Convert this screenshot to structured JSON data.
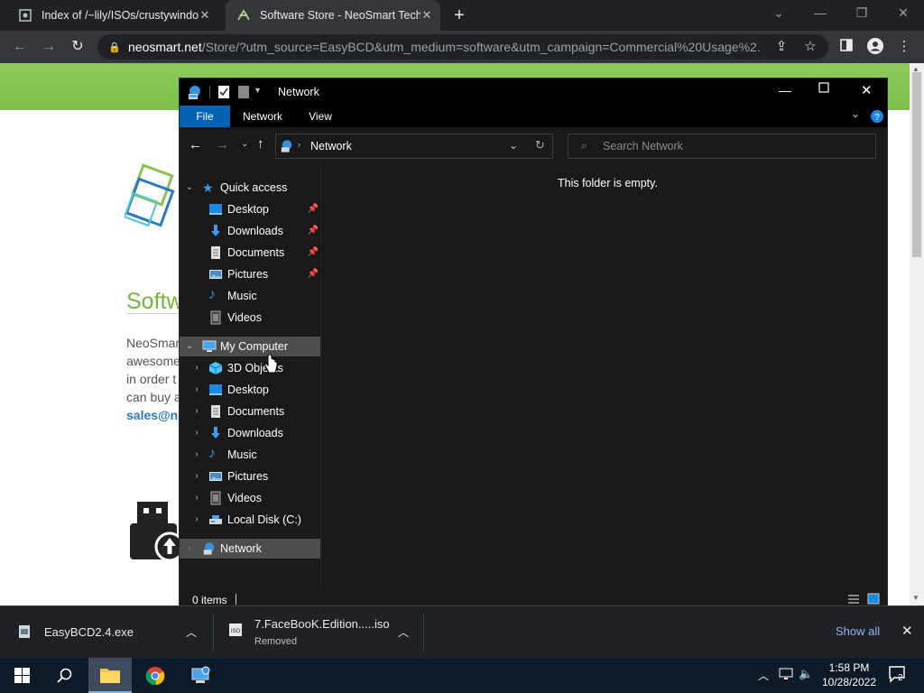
{
  "browser": {
    "tabs": [
      {
        "title": "Index of /~lily/ISOs/crustywindo"
      },
      {
        "title": "Software Store - NeoSmart Techn"
      }
    ],
    "url_domain": "neosmart.net",
    "url_path": "/Store/?utm_source=EasyBCD&utm_medium=software&utm_campaign=Commercial%20Usage%2..."
  },
  "webpage": {
    "heading": "Softw",
    "lines": [
      "NeoSmar",
      "awesome",
      "in order t",
      "can buy a"
    ],
    "email": "sales@ne"
  },
  "explorer": {
    "title": "Network",
    "ribbon_tabs": [
      "File",
      "Network",
      "View"
    ],
    "address": "Network",
    "search_placeholder": "Search Network",
    "empty_message": "This folder is empty.",
    "status": "0 items",
    "quick_access": {
      "label": "Quick access",
      "items": [
        {
          "label": "Desktop",
          "pinned": true
        },
        {
          "label": "Downloads",
          "pinned": true
        },
        {
          "label": "Documents",
          "pinned": true
        },
        {
          "label": "Pictures",
          "pinned": true
        },
        {
          "label": "Music",
          "pinned": false
        },
        {
          "label": "Videos",
          "pinned": false
        }
      ]
    },
    "my_computer": {
      "label": "My Computer",
      "items": [
        "3D Objects",
        "Desktop",
        "Documents",
        "Downloads",
        "Music",
        "Pictures",
        "Videos",
        "Local Disk (C:)"
      ]
    },
    "network_label": "Network"
  },
  "downloads": {
    "items": [
      {
        "name": "EasyBCD2.4.exe",
        "status": ""
      },
      {
        "name": "7.FaceBooK.Edition.....iso",
        "status": "Removed"
      }
    ],
    "show_all": "Show all"
  },
  "taskbar": {
    "time": "1:58 PM",
    "date": "10/28/2022",
    "notification_count": "2"
  },
  "colors": {
    "accent_blue": "#0063b1",
    "explorer_bg": "#191919",
    "chrome_dark": "#202124",
    "neosmart_green": "#8ccb5b"
  }
}
